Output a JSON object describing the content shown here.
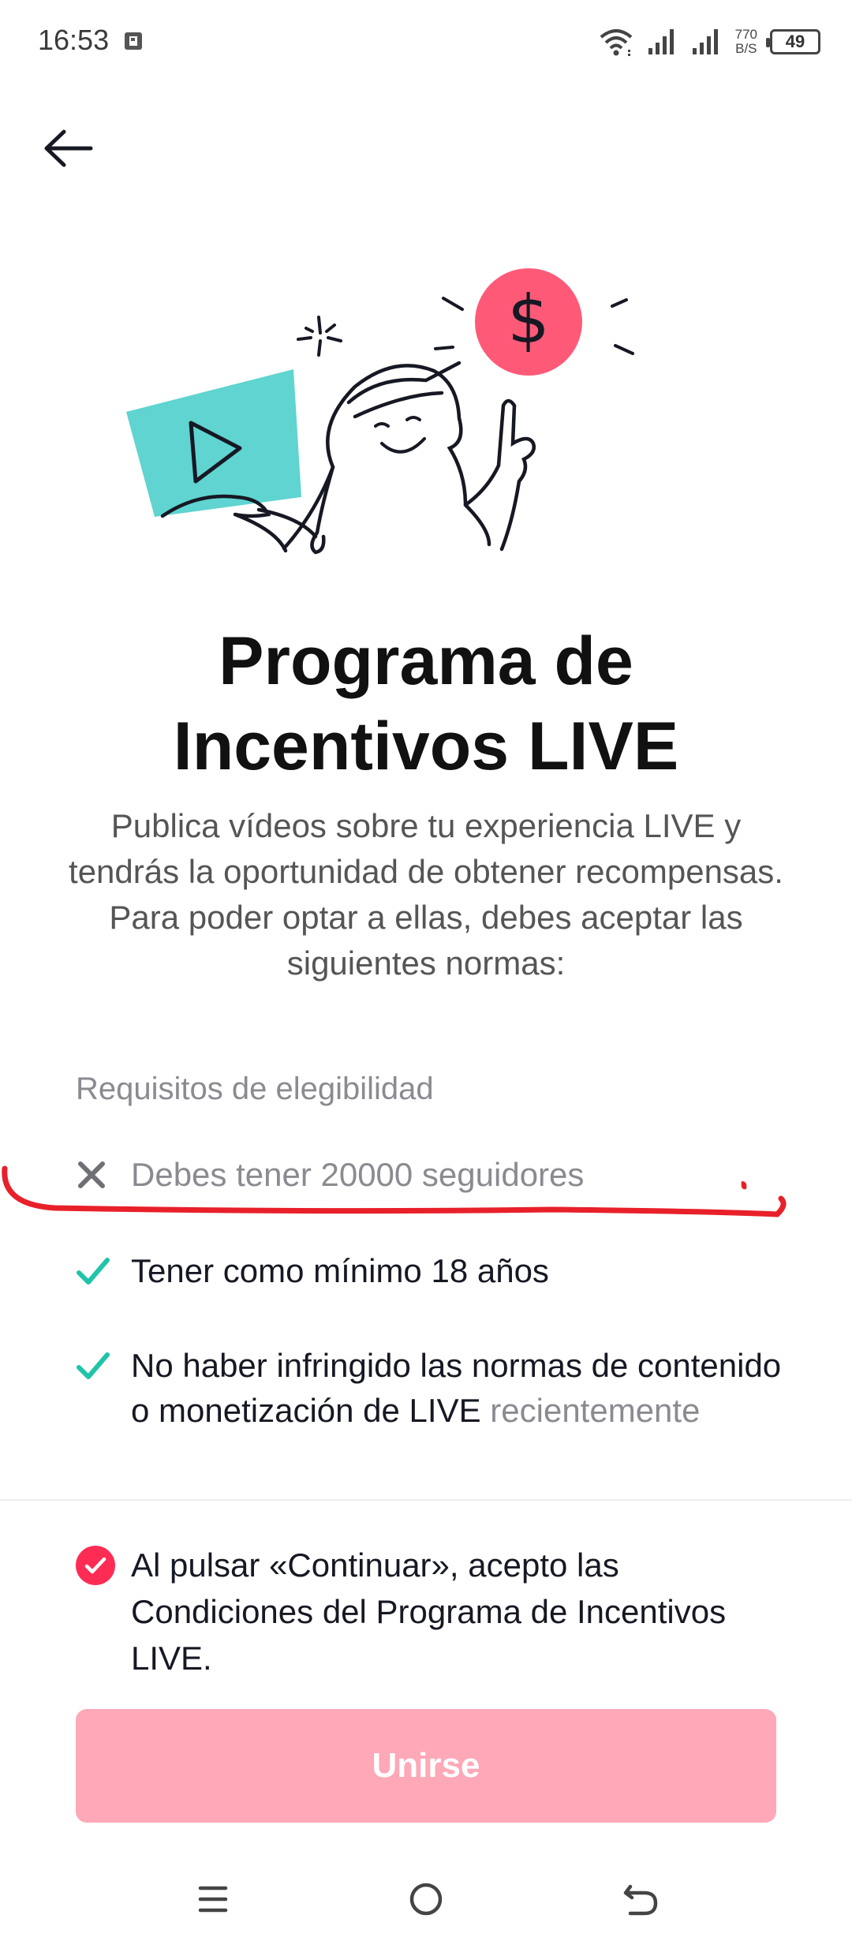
{
  "status_bar": {
    "time": "16:53",
    "net_speed_value": "770",
    "net_speed_unit": "B/S",
    "battery": "49"
  },
  "header": {
    "back_icon": "arrow-left-icon"
  },
  "hero": {
    "title_line1": "Programa de",
    "title_line2": "Incentivos LIVE",
    "description": "Publica vídeos sobre tu experiencia LIVE y tendrás la oportunidad de obtener recompensas. Para poder optar a ellas, debes aceptar las siguientes normas:"
  },
  "eligibility": {
    "label": "Requisitos de elegibilidad",
    "items": [
      {
        "text": "Debes tener 20000 seguidores",
        "status": "unmet",
        "icon": "x-icon"
      },
      {
        "text": "Tener como mínimo 18 años",
        "status": "met",
        "icon": "check-icon"
      },
      {
        "text_main": "No haber infringido las normas de contenido o monetización de LIVE",
        "text_tail": "recientemente",
        "status": "met",
        "icon": "check-icon"
      }
    ]
  },
  "consent": {
    "checked": true,
    "prefix": "Al pulsar «Continuar», acepto las",
    "link": "Condiciones del Programa de Incentivos LIVE."
  },
  "actions": {
    "join_label": "Unirse"
  },
  "colors": {
    "accent": "#fe2c55",
    "button_disabled": "#fea8b8",
    "check_green": "#20c4a8",
    "annotation_red": "#e8202a",
    "illustration_teal": "#5fd4d0",
    "illustration_coin": "#fe5a78"
  },
  "nav": {
    "icons": [
      "menu-icon",
      "home-circle-icon",
      "back-icon"
    ]
  }
}
